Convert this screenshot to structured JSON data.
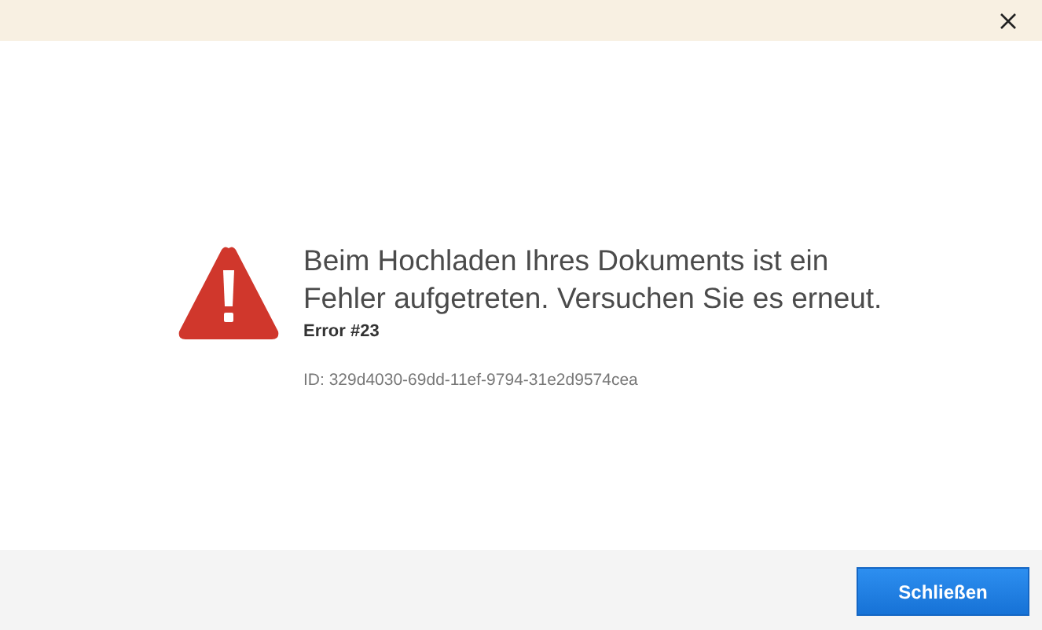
{
  "message": {
    "title": "Beim Hochladen Ihres Dokuments ist ein Fehler aufgetreten. Versuchen Sie es erneut.",
    "code": "Error #23",
    "id": "ID: 329d4030-69dd-11ef-9794-31e2d9574cea"
  },
  "buttons": [
    "Schließen"
  ]
}
